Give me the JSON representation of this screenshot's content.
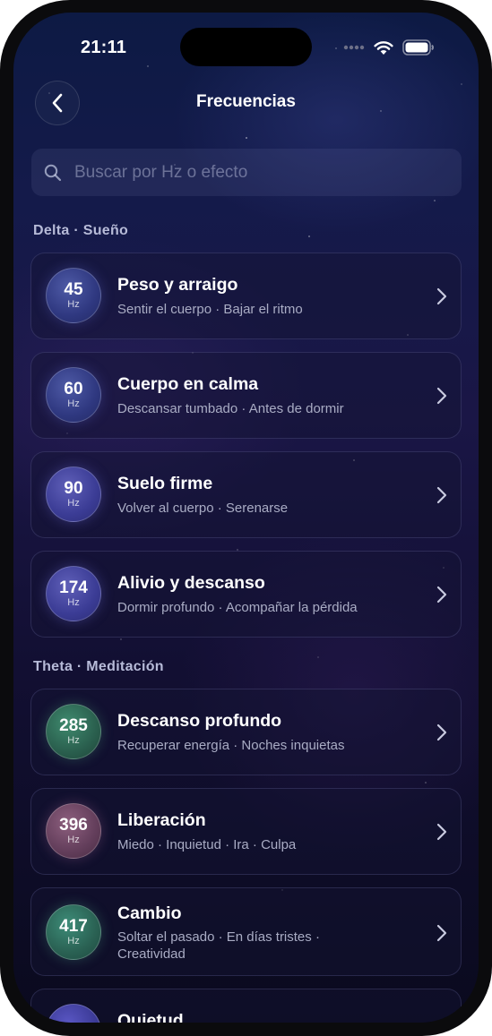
{
  "status_bar": {
    "time": "21:11"
  },
  "header": {
    "title": "Frecuencias"
  },
  "search": {
    "placeholder": "Buscar por Hz o efecto"
  },
  "sections": [
    {
      "label": "Delta · Sueño",
      "items": [
        {
          "hz": "45",
          "unit": "Hz",
          "title": "Peso y arraigo",
          "subtitle": "Sentir el cuerpo · Bajar el ritmo",
          "color": "#2f3880"
        },
        {
          "hz": "60",
          "unit": "Hz",
          "title": "Cuerpo en calma",
          "subtitle": "Descansar tumbado · Antes de dormir",
          "color": "#2f3880"
        },
        {
          "hz": "90",
          "unit": "Hz",
          "title": "Suelo firme",
          "subtitle": "Volver al cuerpo · Serenarse",
          "color": "#3b3c95"
        },
        {
          "hz": "174",
          "unit": "Hz",
          "title": "Alivio y descanso",
          "subtitle": "Dormir profundo · Acompañar la pérdida",
          "color": "#3b3c95"
        }
      ]
    },
    {
      "label": "Theta · Meditación",
      "items": [
        {
          "hz": "285",
          "unit": "Hz",
          "title": "Descanso profundo",
          "subtitle": "Recuperar energía · Noches inquietas",
          "color": "#2a5f4e"
        },
        {
          "hz": "396",
          "unit": "Hz",
          "title": "Liberación",
          "subtitle": "Miedo · Inquietud · Ira · Culpa",
          "color": "#633e5b"
        },
        {
          "hz": "417",
          "unit": "Hz",
          "title": "Cambio",
          "subtitle": "Soltar el pasado · En días tristes · Creatividad",
          "color": "#2a6153"
        },
        {
          "title": "Quietud",
          "color": "#3b3a96"
        }
      ]
    }
  ],
  "icons": {
    "back": "chevron-left-icon",
    "search": "search-icon",
    "row": "chevron-right-icon",
    "signal": "cellular-signal-icon",
    "wifi": "wifi-icon",
    "battery": "battery-icon"
  }
}
